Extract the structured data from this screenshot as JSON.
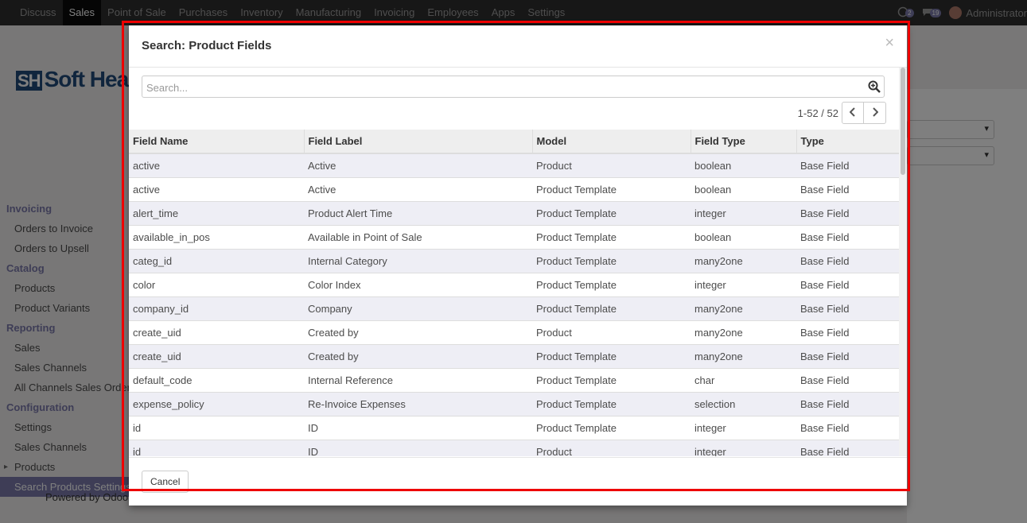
{
  "navbar": {
    "items": [
      "Discuss",
      "Sales",
      "Point of Sale",
      "Purchases",
      "Inventory",
      "Manufacturing",
      "Invoicing",
      "Employees",
      "Apps",
      "Settings"
    ],
    "active_index": 1,
    "messages_count": "2",
    "activity_count": "19",
    "user_name": "Administrator"
  },
  "background": {
    "logo_text": "Soft Hea",
    "logo_mark": "SH",
    "sidebar": [
      {
        "type": "head",
        "label": "Invoicing"
      },
      {
        "type": "item",
        "label": "Orders to Invoice"
      },
      {
        "type": "item",
        "label": "Orders to Upsell"
      },
      {
        "type": "head",
        "label": "Catalog"
      },
      {
        "type": "item",
        "label": "Products"
      },
      {
        "type": "item",
        "label": "Product Variants"
      },
      {
        "type": "head",
        "label": "Reporting"
      },
      {
        "type": "item",
        "label": "Sales"
      },
      {
        "type": "item",
        "label": "Sales Channels"
      },
      {
        "type": "item",
        "label": "All Channels Sales Orders"
      },
      {
        "type": "head",
        "label": "Configuration"
      },
      {
        "type": "item",
        "label": "Settings"
      },
      {
        "type": "item",
        "label": "Sales Channels"
      },
      {
        "type": "item",
        "label": "Products",
        "caret": true
      },
      {
        "type": "item",
        "label": "Search Products Settings",
        "active": true
      }
    ],
    "powered_by": "Powered by Odoo"
  },
  "modal": {
    "title": "Search: Product Fields",
    "close_symbol": "×",
    "search_placeholder": "Search...",
    "pager_value": "1-52 / 52",
    "columns": [
      "Field Name",
      "Field Label",
      "Model",
      "Field Type",
      "Type"
    ],
    "rows": [
      [
        "active",
        "Active",
        "Product",
        "boolean",
        "Base Field"
      ],
      [
        "active",
        "Active",
        "Product Template",
        "boolean",
        "Base Field"
      ],
      [
        "alert_time",
        "Product Alert Time",
        "Product Template",
        "integer",
        "Base Field"
      ],
      [
        "available_in_pos",
        "Available in Point of Sale",
        "Product Template",
        "boolean",
        "Base Field"
      ],
      [
        "categ_id",
        "Internal Category",
        "Product Template",
        "many2one",
        "Base Field"
      ],
      [
        "color",
        "Color Index",
        "Product Template",
        "integer",
        "Base Field"
      ],
      [
        "company_id",
        "Company",
        "Product Template",
        "many2one",
        "Base Field"
      ],
      [
        "create_uid",
        "Created by",
        "Product",
        "many2one",
        "Base Field"
      ],
      [
        "create_uid",
        "Created by",
        "Product Template",
        "many2one",
        "Base Field"
      ],
      [
        "default_code",
        "Internal Reference",
        "Product Template",
        "char",
        "Base Field"
      ],
      [
        "expense_policy",
        "Re-Invoice Expenses",
        "Product Template",
        "selection",
        "Base Field"
      ],
      [
        "id",
        "ID",
        "Product Template",
        "integer",
        "Base Field"
      ],
      [
        "id",
        "ID",
        "Product",
        "integer",
        "Base Field"
      ]
    ],
    "cancel_label": "Cancel"
  },
  "colors": {
    "highlight": "#ee0000",
    "accent": "#7c7bad",
    "navbar": "#2f2f2f"
  }
}
